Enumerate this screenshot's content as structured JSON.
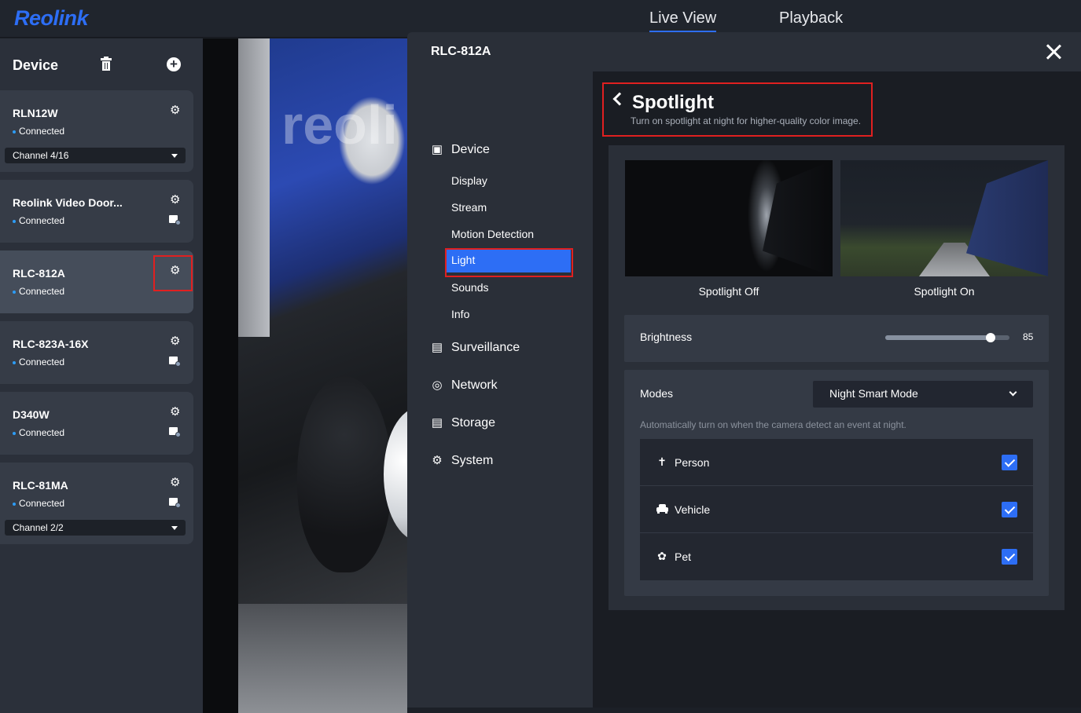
{
  "topbar": {
    "logo": "Reolink",
    "tabs": [
      {
        "label": "Live View",
        "active": true
      },
      {
        "label": "Playback",
        "active": false
      }
    ]
  },
  "sidebar": {
    "title": "Device",
    "devices": [
      {
        "name": "RLN12W",
        "status": "Connected",
        "channel": "Channel 4/16"
      },
      {
        "name": "Reolink Video Door...",
        "status": "Connected"
      },
      {
        "name": "RLC-812A",
        "status": "Connected",
        "active": true
      },
      {
        "name": "RLC-823A-16X",
        "status": "Connected"
      },
      {
        "name": "D340W",
        "status": "Connected"
      },
      {
        "name": "RLC-81MA",
        "status": "Connected",
        "channel": "Channel 2/2"
      }
    ]
  },
  "video": {
    "watermark": "reoli"
  },
  "modal": {
    "title": "RLC-812A",
    "menu": {
      "groups": [
        {
          "label": "Device",
          "icon": "camera-icon"
        },
        {
          "label": "Surveillance",
          "icon": "monitor-icon"
        },
        {
          "label": "Network",
          "icon": "globe-icon"
        },
        {
          "label": "Storage",
          "icon": "hard-drive-icon"
        },
        {
          "label": "System",
          "icon": "gear-icon"
        }
      ],
      "device_items": [
        "Display",
        "Stream",
        "Motion Detection",
        "Light",
        "Sounds",
        "Info"
      ],
      "selected": "Light"
    },
    "spotlight": {
      "title": "Spotlight",
      "subtitle": "Turn on spotlight at night for higher-quality color image.",
      "preview_off_label": "Spotlight Off",
      "preview_on_label": "Spotlight On",
      "brightness_label": "Brightness",
      "brightness_value": 85,
      "brightness_display": "85",
      "modes_label": "Modes",
      "mode_selected": "Night Smart Mode",
      "modes_note": "Automatically turn on when the camera detect an event at night.",
      "options": [
        {
          "label": "Person",
          "icon": "person-running-icon",
          "checked": true
        },
        {
          "label": "Vehicle",
          "icon": "car-icon",
          "checked": true
        },
        {
          "label": "Pet",
          "icon": "paw-icon",
          "checked": true
        }
      ]
    }
  },
  "colors": {
    "accent": "#2d6ef5",
    "highlight": "#e02020"
  }
}
